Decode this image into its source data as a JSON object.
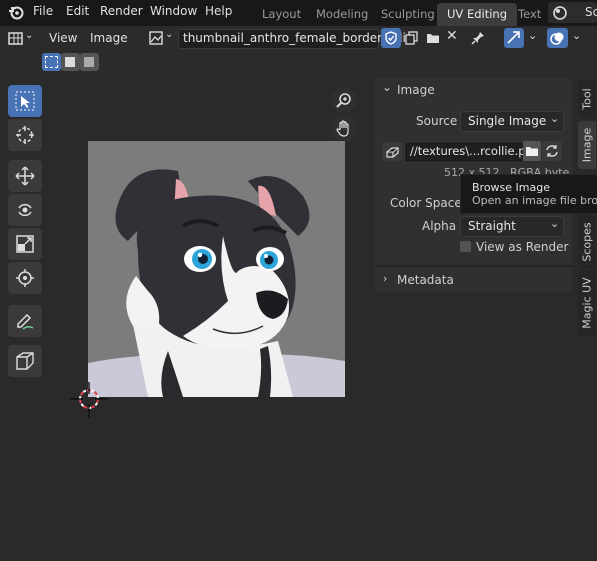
{
  "topbar": {
    "menus": [
      "File",
      "Edit",
      "Render",
      "Window",
      "Help"
    ],
    "workspaces": [
      "Layout",
      "Modeling",
      "Sculpting",
      "UV Editing",
      "Text"
    ],
    "active_workspace": "UV Editing",
    "scene_partial": "Sc"
  },
  "header": {
    "view_label": "View",
    "image_label": "Image",
    "image_name": "thumbnail_anthro_female_bordercollie"
  },
  "panel": {
    "image_section": "Image",
    "source_label": "Source",
    "source_value": "Single Image",
    "filepath": "//textures\\...rcollie.png",
    "info_partial": "512 x 512 , RGBA byte",
    "color_space_label": "Color Space",
    "alpha_label": "Alpha",
    "alpha_value": "Straight",
    "view_as_render": "View as Render",
    "metadata_section": "Metadata"
  },
  "tooltip": {
    "title": "Browse Image",
    "desc": "Open an image file browser"
  },
  "tabs": [
    "Tool",
    "Image",
    "Scopes",
    "Magic UV"
  ],
  "active_tab": "Image",
  "colors": {
    "accent": "#4772b3",
    "topbar": "#181818",
    "bg": "#2a2a2a",
    "panel": "#303030"
  }
}
